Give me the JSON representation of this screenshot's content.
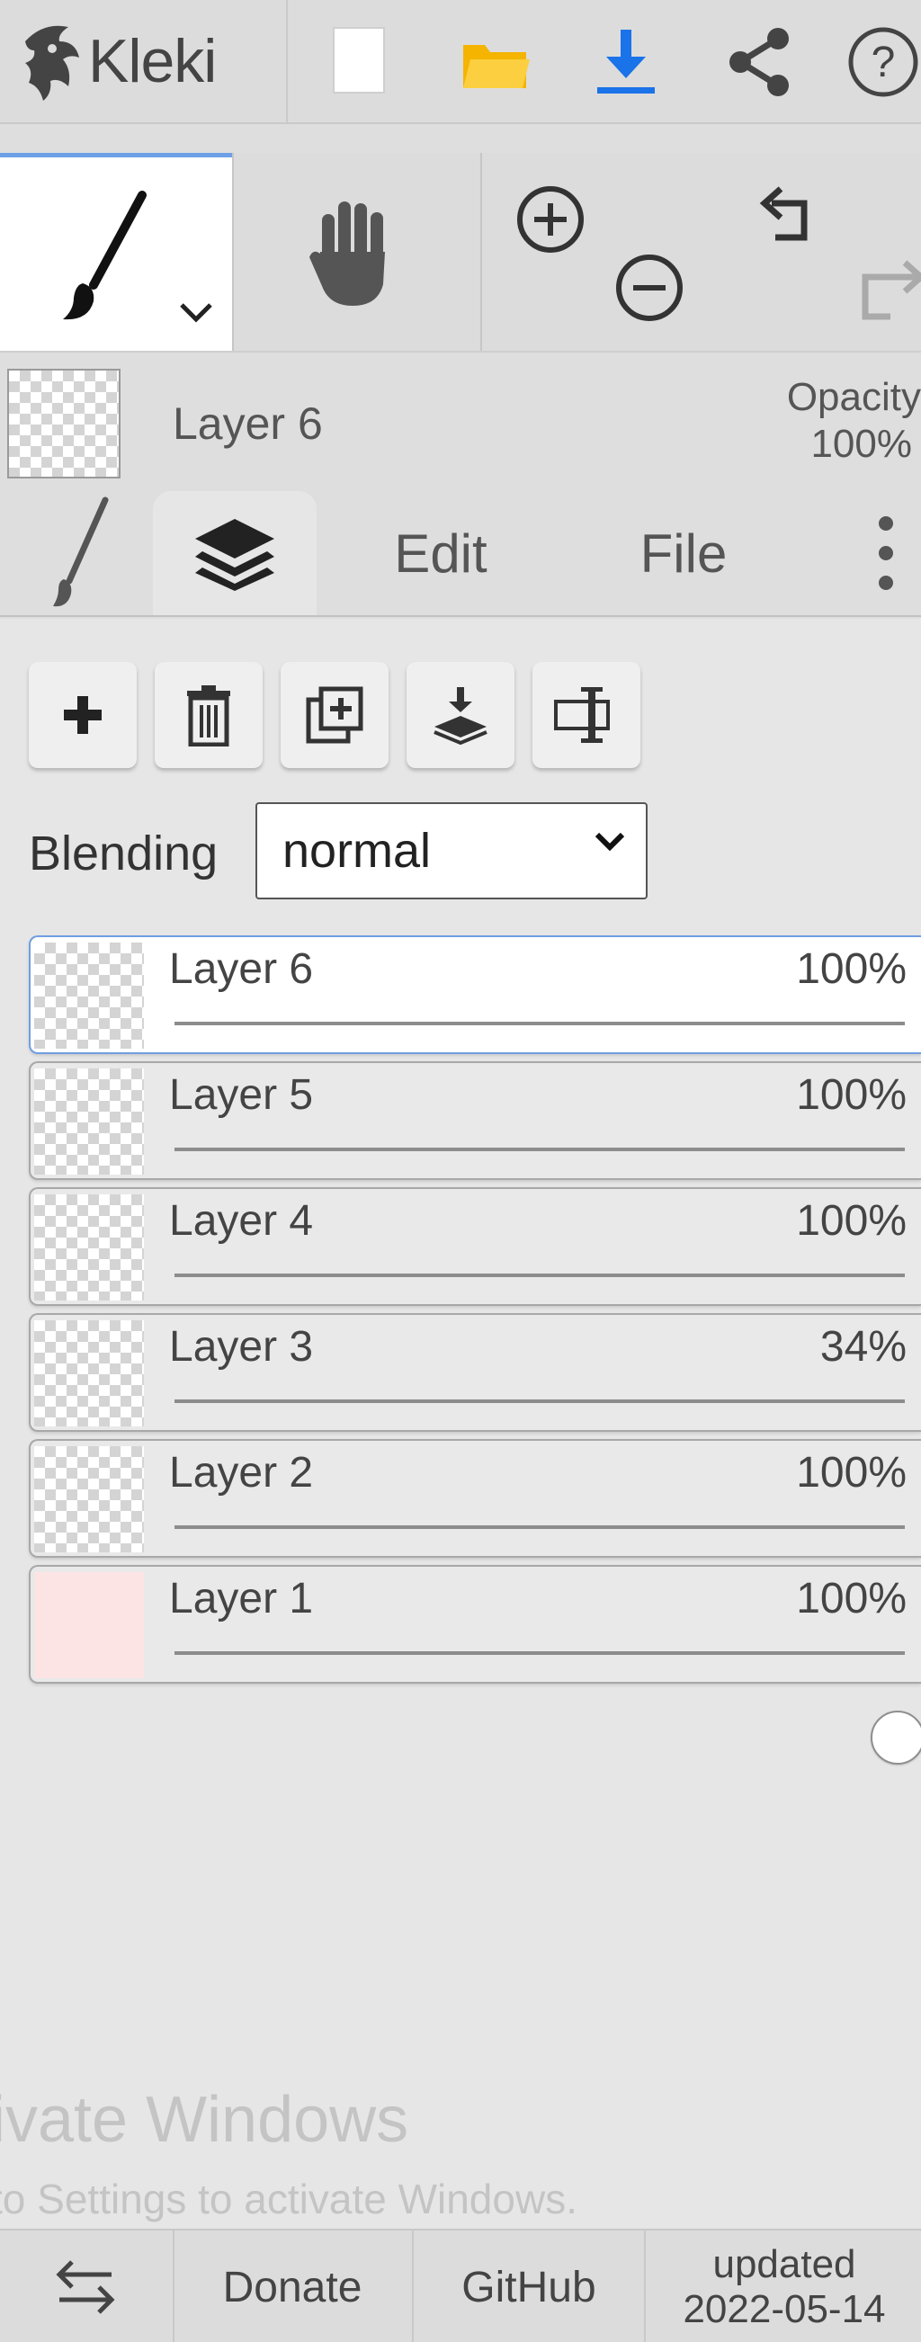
{
  "app": {
    "name": "Kleki"
  },
  "toolbar": {
    "icons": [
      "new-image-icon",
      "open-folder-icon",
      "download-icon",
      "share-icon",
      "help-icon"
    ],
    "download_accent": "#1a73e8",
    "folder_color": "#f4b400"
  },
  "tools": {
    "items": [
      "brush-tool",
      "hand-tool",
      "zoom-in",
      "zoom-out",
      "undo",
      "redo"
    ],
    "active": "brush-tool",
    "active_accent": "#6da0e6"
  },
  "current_layer": {
    "name": "Layer 6",
    "opacity_label": "Opacity",
    "opacity_value": "100%"
  },
  "tabs": {
    "active": "layers",
    "edit": "Edit",
    "file": "File"
  },
  "layers_panel": {
    "buttons": [
      "add-layer",
      "delete-layer",
      "duplicate-layer",
      "merge-down",
      "rename-layer"
    ],
    "blending": {
      "label": "Blending",
      "value": "normal"
    },
    "layers": [
      {
        "name": "Layer 6",
        "opacity": "100%",
        "level": 1.0,
        "active": true,
        "thumb": "transparent"
      },
      {
        "name": "Layer 5",
        "opacity": "100%",
        "level": 1.0,
        "active": false,
        "thumb": "transparent"
      },
      {
        "name": "Layer 4",
        "opacity": "100%",
        "level": 1.0,
        "active": false,
        "thumb": "transparent"
      },
      {
        "name": "Layer 3",
        "opacity": "34%",
        "level": 0.34,
        "active": false,
        "thumb": "transparent"
      },
      {
        "name": "Layer 2",
        "opacity": "100%",
        "level": 1.0,
        "active": false,
        "thumb": "transparent"
      },
      {
        "name": "Layer 1",
        "opacity": "100%",
        "level": 1.0,
        "active": false,
        "thumb": "#fde4e4"
      }
    ]
  },
  "watermark": {
    "line1": "tivate Windows",
    "line2": "to Settings to activate Windows."
  },
  "footer": {
    "donate": "Donate",
    "github": "GitHub",
    "updated_label": "updated",
    "updated_date": "2022-05-14"
  }
}
